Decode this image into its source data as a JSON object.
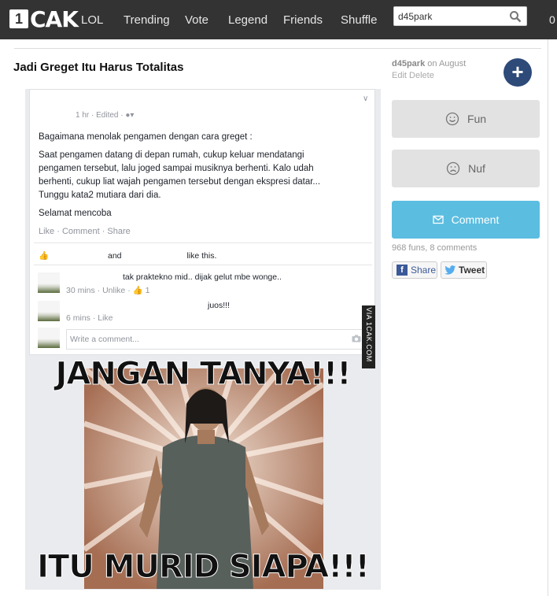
{
  "brand": {
    "logo_num": "1",
    "logo_text": "CAK"
  },
  "nav": [
    "LOL",
    "Trending",
    "Vote",
    "Legend",
    "Friends",
    "Shuffle"
  ],
  "search": {
    "value": "d45park"
  },
  "counter": "0",
  "post": {
    "title": "Jadi Greget Itu Harus Totalitas",
    "author": "d45park",
    "posted": "on August",
    "edit": "Edit",
    "delete": "Delete"
  },
  "buttons": {
    "fun": "Fun",
    "nuf": "Nuf",
    "comment": "Comment",
    "plus": "+"
  },
  "stats": "968 funs, 8 comments",
  "share": {
    "facebook": "Share",
    "twitter": "Tweet"
  },
  "meme": {
    "fb": {
      "time": "1 hr · Edited · ",
      "p1": "Bagaimana menolak pengamen dengan cara greget :",
      "p2": "Saat pengamen datang di depan rumah, cukup keluar mendatangi",
      "p3": "pengamen tersebut, lalu joged sampai musiknya berhenti. Kalo udah",
      "p4": "berhenti, cukup liat wajah pengamen tersebut dengan ekspresi datar...",
      "p5": "Tunggu kata2 mutiara dari dia.",
      "p6": "Selamat mencoba",
      "actions": "Like · Comment · Share",
      "likes_and": "and",
      "likes_tail": "like this.",
      "c1_text": "tak praktekno mid.. dijak gelut mbe wonge..",
      "c1_meta": "30 mins · Unlike · ",
      "c1_count": "1",
      "c2_text": "juos!!!",
      "c2_meta": "6 mins · Like",
      "write": "Write a comment..."
    },
    "via": "VIA 1CAK.COM",
    "top_text": "JANGAN TANYA!!!",
    "bottom_text": "ITU MURID SIAPA!!!"
  }
}
